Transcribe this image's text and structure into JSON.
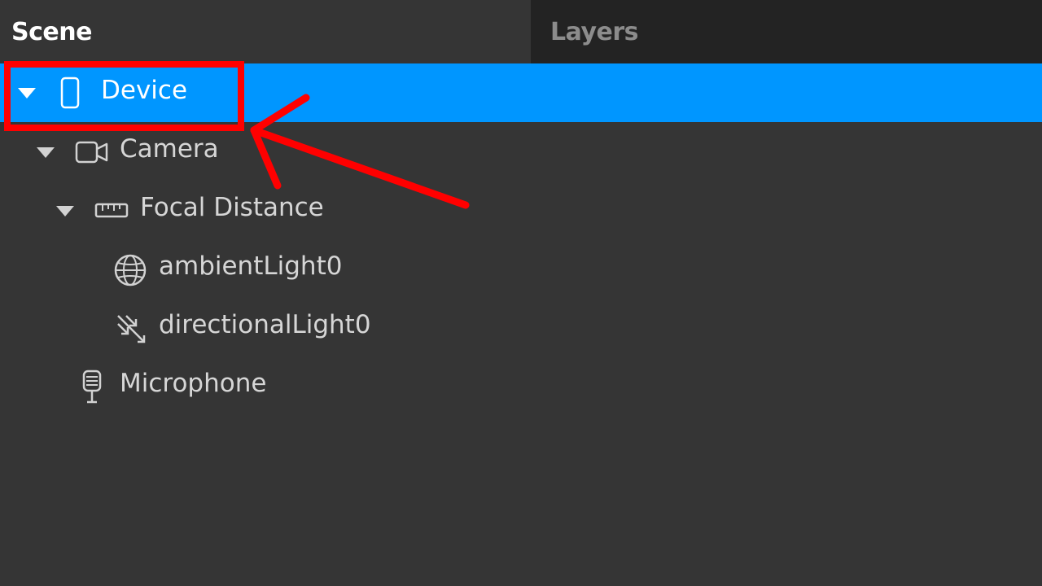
{
  "tabs": {
    "scene_label": "Scene",
    "layers_label": "Layers"
  },
  "tree": {
    "items": [
      {
        "label": "Device",
        "icon": "phone-icon",
        "expanded": true,
        "selected": true
      },
      {
        "label": "Camera",
        "icon": "video-camera-icon",
        "expanded": true,
        "selected": false
      },
      {
        "label": "Focal Distance",
        "icon": "ruler-icon",
        "expanded": true,
        "selected": false
      },
      {
        "label": "ambientLight0",
        "icon": "globe-icon",
        "selected": false
      },
      {
        "label": "directionalLight0",
        "icon": "directional-light-icon",
        "selected": false
      },
      {
        "label": "Microphone",
        "icon": "microphone-icon",
        "selected": false
      }
    ]
  },
  "colors": {
    "panel_bg": "#353535",
    "tabbar_bg": "#232323",
    "selection": "#0096ff",
    "annotation": "#ff0000"
  }
}
